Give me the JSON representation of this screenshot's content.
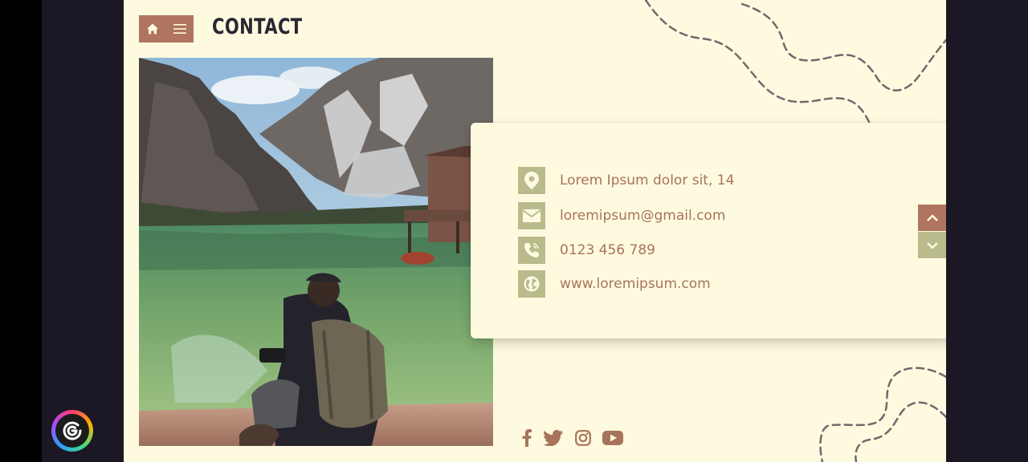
{
  "page": {
    "title": "CONTACT",
    "colors": {
      "background": "#fefadf",
      "accent": "#b0755f",
      "icon_bg": "#b9bb8c",
      "text": "#a8735b",
      "title": "#2c2633"
    }
  },
  "nav": {
    "home_icon": "home-icon",
    "menu_icon": "hamburger-menu-icon"
  },
  "photo": {
    "subject": "hiker with backpack and camera sitting by a green mountain lake with boathouse"
  },
  "contact": {
    "items": [
      {
        "icon": "location-pin-icon",
        "text": "Lorem Ipsum dolor sit, 14"
      },
      {
        "icon": "envelope-icon",
        "text": "loremipsum@gmail.com"
      },
      {
        "icon": "phone-icon",
        "text": "0123 456 789"
      },
      {
        "icon": "globe-icon",
        "text": "www.loremipsum.com"
      }
    ]
  },
  "scroll": {
    "up_icon": "chevron-up-icon",
    "down_icon": "chevron-down-icon"
  },
  "social": [
    "facebook-icon",
    "twitter-icon",
    "instagram-icon",
    "youtube-icon"
  ],
  "fab": {
    "icon": "assistant-icon"
  }
}
